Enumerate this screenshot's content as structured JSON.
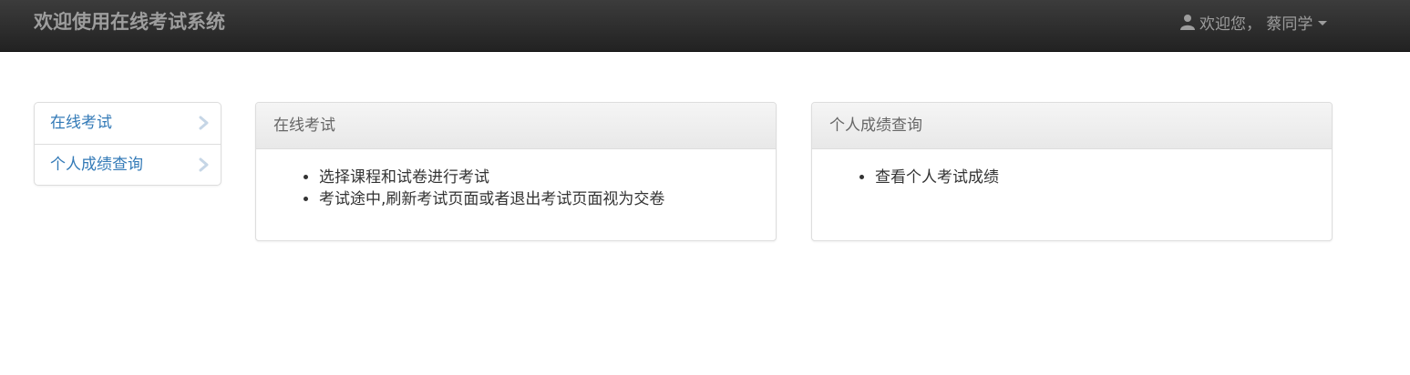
{
  "navbar": {
    "brand": "欢迎使用在线考试系统",
    "user_greeting": "欢迎您， 蔡同学",
    "user_icon": "user-icon",
    "caret_icon": "caret-down-icon"
  },
  "sidebar": {
    "items": [
      {
        "label": "在线考试",
        "icon": "chevron-right-icon"
      },
      {
        "label": "个人成绩查询",
        "icon": "chevron-right-icon"
      }
    ]
  },
  "panels": [
    {
      "title": "在线考试",
      "items": [
        "选择课程和试卷进行考试",
        "考试途中,刷新考试页面或者退出考试页面视为交卷"
      ]
    },
    {
      "title": "个人成绩查询",
      "items": [
        "查看个人考试成绩"
      ]
    }
  ],
  "colors": {
    "navbar_bg": "#222222",
    "navbar_text": "#9d9d9d",
    "link": "#337ab7",
    "chevron": "#c6d6e6"
  }
}
